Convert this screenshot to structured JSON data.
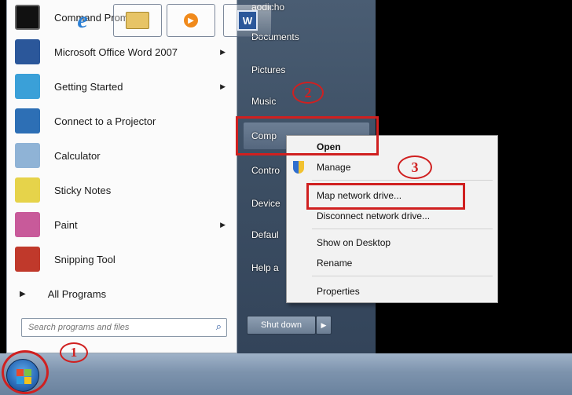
{
  "start_menu": {
    "programs": [
      {
        "label": "Command Prompt",
        "icon": "command-prompt-icon",
        "color": "#1a1a1a",
        "submenu": false
      },
      {
        "label": "Microsoft Office Word 2007",
        "icon": "word-icon",
        "color": "#2b579a",
        "submenu": true
      },
      {
        "label": "Getting Started",
        "icon": "getting-started-icon",
        "color": "#3aa0d8",
        "submenu": true
      },
      {
        "label": "Connect to a Projector",
        "icon": "projector-icon",
        "color": "#2d6fb5",
        "submenu": false
      },
      {
        "label": "Calculator",
        "icon": "calculator-icon",
        "color": "#8fb3d6",
        "submenu": false
      },
      {
        "label": "Sticky Notes",
        "icon": "sticky-notes-icon",
        "color": "#e6d34a",
        "submenu": false
      },
      {
        "label": "Paint",
        "icon": "paint-icon",
        "color": "#c85a9a",
        "submenu": true
      },
      {
        "label": "Snipping Tool",
        "icon": "snipping-tool-icon",
        "color": "#c0392b",
        "submenu": false
      }
    ],
    "all_programs": "All Programs",
    "search_placeholder": "Search programs and files",
    "right_links": [
      "aodicho",
      "Documents",
      "Pictures",
      "Music",
      "Comp",
      "Contro",
      "Device",
      "Defaul",
      "Help a"
    ],
    "shutdown_label": "Shut down"
  },
  "context_menu": {
    "items": [
      "Open",
      "Manage",
      "Map network drive...",
      "Disconnect network drive...",
      "Show on Desktop",
      "Rename",
      "Properties"
    ]
  },
  "annotations": [
    "1",
    "2",
    "3"
  ],
  "taskbar": {
    "apps": [
      "internet-explorer-icon",
      "file-explorer-icon",
      "media-player-icon",
      "word-icon"
    ]
  },
  "colors": {
    "annotation_red": "#d02020",
    "start_right_pane": "#3c4e63"
  }
}
